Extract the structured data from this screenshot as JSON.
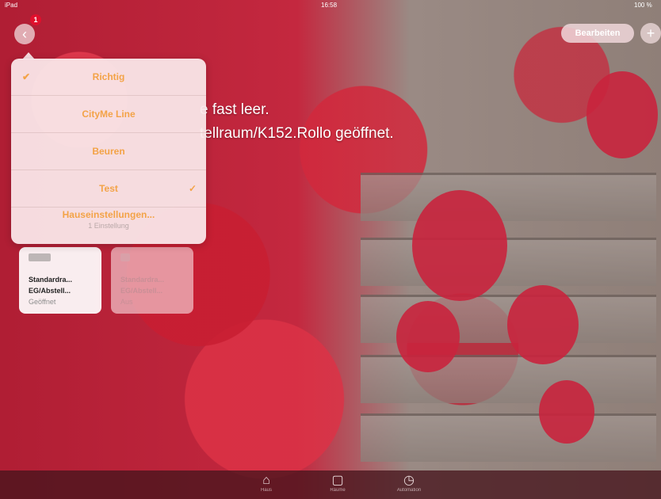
{
  "status_bar": {
    "left": "iPad",
    "time": "16:58",
    "right": "100 %"
  },
  "header": {
    "back_icon": "back-arrow-icon",
    "badge_count": "1",
    "edit_label": "Bearbeiten",
    "add_icon": "plus-icon"
  },
  "message": {
    "line1": "e fast leer.",
    "line2": "tellraum/K152.Rollo geöffnet."
  },
  "menu": {
    "items": [
      {
        "label": "Richtig",
        "checked_left": "✔"
      },
      {
        "label": "CityMe Line"
      },
      {
        "label": "Beuren"
      },
      {
        "label": "Test",
        "checked_right": "✓"
      },
      {
        "label": "Hauseinstellungen...",
        "subtext": "1 Einstellung"
      }
    ]
  },
  "tiles": [
    {
      "line1": "Standardra...",
      "line2": "EG/Abstell...",
      "status": "Geöffnet"
    },
    {
      "line1": "Standardra...",
      "line2": "EG/Abstell...",
      "status": "Aus"
    }
  ],
  "tabbar": {
    "tabs": [
      {
        "icon": "house-icon",
        "label": "Haus"
      },
      {
        "icon": "rooms-icon",
        "label": "Räume"
      },
      {
        "icon": "automation-icon",
        "label": "Automation"
      }
    ]
  },
  "colors": {
    "accent": "#f3a347",
    "badge": "#e0102d"
  }
}
